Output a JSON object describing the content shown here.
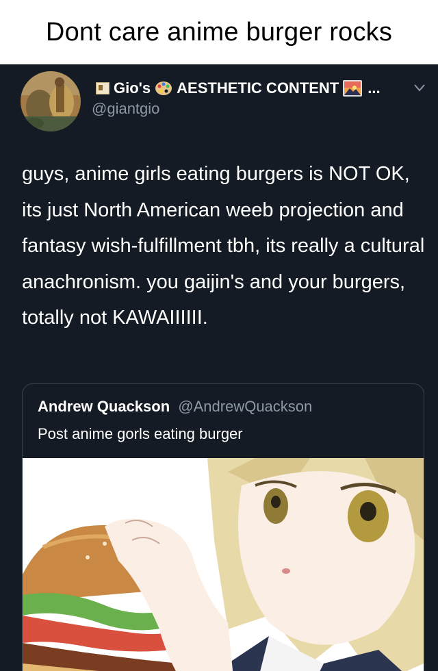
{
  "caption": "Dont care anime burger rocks",
  "tweet": {
    "display_name": "Gio's",
    "display_name_rest": "AESTHETIC CONTENT",
    "handle": "@giantgio",
    "ellipsis": "...",
    "body": "guys, anime girls eating burgers is NOT OK, its just North American weeb projection and fantasy wish-fulfillment tbh, its really a cultural anachronism. you gaijin's and your burgers, totally not KAWAIIIIII."
  },
  "quote": {
    "author": "Andrew Quackson",
    "handle": "@AndrewQuackson",
    "text": "Post anime gorls eating burger"
  },
  "icons": {
    "badge": "newspaper-badge-icon",
    "palette": "palette-icon",
    "sunset": "sunset-icon",
    "chevron": "chevron-down-icon"
  },
  "colors": {
    "tweet_bg": "#151b24",
    "secondary_text": "#8b98a5",
    "border": "#38444d"
  }
}
